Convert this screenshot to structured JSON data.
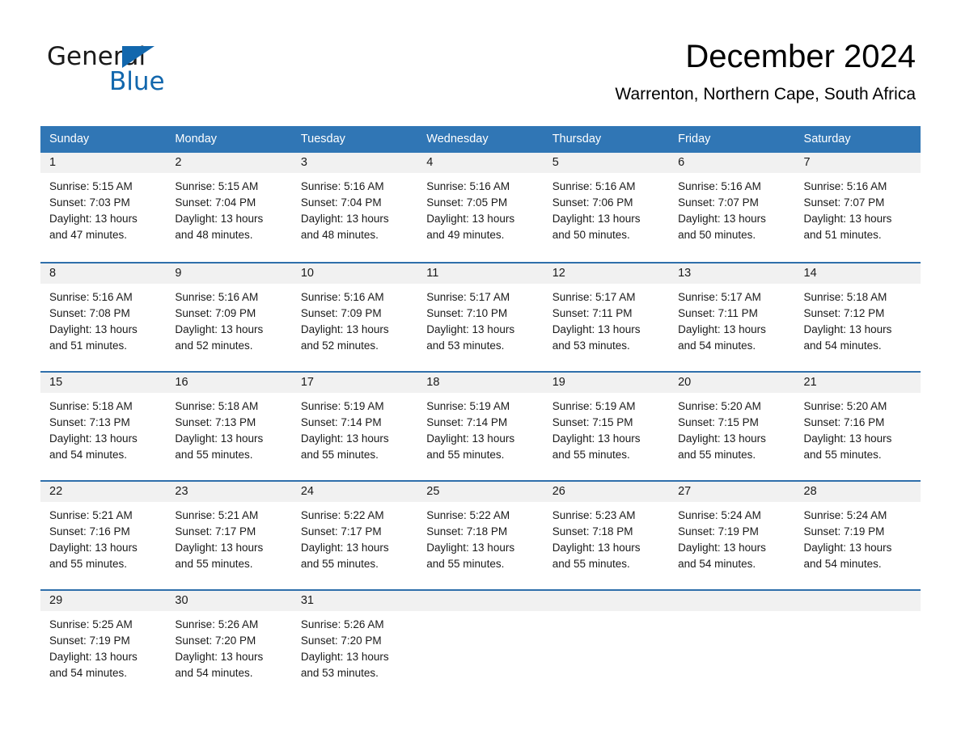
{
  "brand": {
    "name_part1": "General",
    "name_part2": "Blue",
    "accent_color": "#1267ad"
  },
  "header": {
    "month_title": "December 2024",
    "location": "Warrenton, Northern Cape, South Africa"
  },
  "calendar": {
    "header_color": "#3076b5",
    "row_border_color": "#2f6fab",
    "day_band_color": "#f1f1f1",
    "weekdays": [
      "Sunday",
      "Monday",
      "Tuesday",
      "Wednesday",
      "Thursday",
      "Friday",
      "Saturday"
    ],
    "weeks": [
      [
        {
          "day": "1",
          "sunrise": "Sunrise: 5:15 AM",
          "sunset": "Sunset: 7:03 PM",
          "daylight_line1": "Daylight: 13 hours",
          "daylight_line2": "and 47 minutes."
        },
        {
          "day": "2",
          "sunrise": "Sunrise: 5:15 AM",
          "sunset": "Sunset: 7:04 PM",
          "daylight_line1": "Daylight: 13 hours",
          "daylight_line2": "and 48 minutes."
        },
        {
          "day": "3",
          "sunrise": "Sunrise: 5:16 AM",
          "sunset": "Sunset: 7:04 PM",
          "daylight_line1": "Daylight: 13 hours",
          "daylight_line2": "and 48 minutes."
        },
        {
          "day": "4",
          "sunrise": "Sunrise: 5:16 AM",
          "sunset": "Sunset: 7:05 PM",
          "daylight_line1": "Daylight: 13 hours",
          "daylight_line2": "and 49 minutes."
        },
        {
          "day": "5",
          "sunrise": "Sunrise: 5:16 AM",
          "sunset": "Sunset: 7:06 PM",
          "daylight_line1": "Daylight: 13 hours",
          "daylight_line2": "and 50 minutes."
        },
        {
          "day": "6",
          "sunrise": "Sunrise: 5:16 AM",
          "sunset": "Sunset: 7:07 PM",
          "daylight_line1": "Daylight: 13 hours",
          "daylight_line2": "and 50 minutes."
        },
        {
          "day": "7",
          "sunrise": "Sunrise: 5:16 AM",
          "sunset": "Sunset: 7:07 PM",
          "daylight_line1": "Daylight: 13 hours",
          "daylight_line2": "and 51 minutes."
        }
      ],
      [
        {
          "day": "8",
          "sunrise": "Sunrise: 5:16 AM",
          "sunset": "Sunset: 7:08 PM",
          "daylight_line1": "Daylight: 13 hours",
          "daylight_line2": "and 51 minutes."
        },
        {
          "day": "9",
          "sunrise": "Sunrise: 5:16 AM",
          "sunset": "Sunset: 7:09 PM",
          "daylight_line1": "Daylight: 13 hours",
          "daylight_line2": "and 52 minutes."
        },
        {
          "day": "10",
          "sunrise": "Sunrise: 5:16 AM",
          "sunset": "Sunset: 7:09 PM",
          "daylight_line1": "Daylight: 13 hours",
          "daylight_line2": "and 52 minutes."
        },
        {
          "day": "11",
          "sunrise": "Sunrise: 5:17 AM",
          "sunset": "Sunset: 7:10 PM",
          "daylight_line1": "Daylight: 13 hours",
          "daylight_line2": "and 53 minutes."
        },
        {
          "day": "12",
          "sunrise": "Sunrise: 5:17 AM",
          "sunset": "Sunset: 7:11 PM",
          "daylight_line1": "Daylight: 13 hours",
          "daylight_line2": "and 53 minutes."
        },
        {
          "day": "13",
          "sunrise": "Sunrise: 5:17 AM",
          "sunset": "Sunset: 7:11 PM",
          "daylight_line1": "Daylight: 13 hours",
          "daylight_line2": "and 54 minutes."
        },
        {
          "day": "14",
          "sunrise": "Sunrise: 5:18 AM",
          "sunset": "Sunset: 7:12 PM",
          "daylight_line1": "Daylight: 13 hours",
          "daylight_line2": "and 54 minutes."
        }
      ],
      [
        {
          "day": "15",
          "sunrise": "Sunrise: 5:18 AM",
          "sunset": "Sunset: 7:13 PM",
          "daylight_line1": "Daylight: 13 hours",
          "daylight_line2": "and 54 minutes."
        },
        {
          "day": "16",
          "sunrise": "Sunrise: 5:18 AM",
          "sunset": "Sunset: 7:13 PM",
          "daylight_line1": "Daylight: 13 hours",
          "daylight_line2": "and 55 minutes."
        },
        {
          "day": "17",
          "sunrise": "Sunrise: 5:19 AM",
          "sunset": "Sunset: 7:14 PM",
          "daylight_line1": "Daylight: 13 hours",
          "daylight_line2": "and 55 minutes."
        },
        {
          "day": "18",
          "sunrise": "Sunrise: 5:19 AM",
          "sunset": "Sunset: 7:14 PM",
          "daylight_line1": "Daylight: 13 hours",
          "daylight_line2": "and 55 minutes."
        },
        {
          "day": "19",
          "sunrise": "Sunrise: 5:19 AM",
          "sunset": "Sunset: 7:15 PM",
          "daylight_line1": "Daylight: 13 hours",
          "daylight_line2": "and 55 minutes."
        },
        {
          "day": "20",
          "sunrise": "Sunrise: 5:20 AM",
          "sunset": "Sunset: 7:15 PM",
          "daylight_line1": "Daylight: 13 hours",
          "daylight_line2": "and 55 minutes."
        },
        {
          "day": "21",
          "sunrise": "Sunrise: 5:20 AM",
          "sunset": "Sunset: 7:16 PM",
          "daylight_line1": "Daylight: 13 hours",
          "daylight_line2": "and 55 minutes."
        }
      ],
      [
        {
          "day": "22",
          "sunrise": "Sunrise: 5:21 AM",
          "sunset": "Sunset: 7:16 PM",
          "daylight_line1": "Daylight: 13 hours",
          "daylight_line2": "and 55 minutes."
        },
        {
          "day": "23",
          "sunrise": "Sunrise: 5:21 AM",
          "sunset": "Sunset: 7:17 PM",
          "daylight_line1": "Daylight: 13 hours",
          "daylight_line2": "and 55 minutes."
        },
        {
          "day": "24",
          "sunrise": "Sunrise: 5:22 AM",
          "sunset": "Sunset: 7:17 PM",
          "daylight_line1": "Daylight: 13 hours",
          "daylight_line2": "and 55 minutes."
        },
        {
          "day": "25",
          "sunrise": "Sunrise: 5:22 AM",
          "sunset": "Sunset: 7:18 PM",
          "daylight_line1": "Daylight: 13 hours",
          "daylight_line2": "and 55 minutes."
        },
        {
          "day": "26",
          "sunrise": "Sunrise: 5:23 AM",
          "sunset": "Sunset: 7:18 PM",
          "daylight_line1": "Daylight: 13 hours",
          "daylight_line2": "and 55 minutes."
        },
        {
          "day": "27",
          "sunrise": "Sunrise: 5:24 AM",
          "sunset": "Sunset: 7:19 PM",
          "daylight_line1": "Daylight: 13 hours",
          "daylight_line2": "and 54 minutes."
        },
        {
          "day": "28",
          "sunrise": "Sunrise: 5:24 AM",
          "sunset": "Sunset: 7:19 PM",
          "daylight_line1": "Daylight: 13 hours",
          "daylight_line2": "and 54 minutes."
        }
      ],
      [
        {
          "day": "29",
          "sunrise": "Sunrise: 5:25 AM",
          "sunset": "Sunset: 7:19 PM",
          "daylight_line1": "Daylight: 13 hours",
          "daylight_line2": "and 54 minutes."
        },
        {
          "day": "30",
          "sunrise": "Sunrise: 5:26 AM",
          "sunset": "Sunset: 7:20 PM",
          "daylight_line1": "Daylight: 13 hours",
          "daylight_line2": "and 54 minutes."
        },
        {
          "day": "31",
          "sunrise": "Sunrise: 5:26 AM",
          "sunset": "Sunset: 7:20 PM",
          "daylight_line1": "Daylight: 13 hours",
          "daylight_line2": "and 53 minutes."
        },
        {
          "day": "",
          "sunrise": "",
          "sunset": "",
          "daylight_line1": "",
          "daylight_line2": ""
        },
        {
          "day": "",
          "sunrise": "",
          "sunset": "",
          "daylight_line1": "",
          "daylight_line2": ""
        },
        {
          "day": "",
          "sunrise": "",
          "sunset": "",
          "daylight_line1": "",
          "daylight_line2": ""
        },
        {
          "day": "",
          "sunrise": "",
          "sunset": "",
          "daylight_line1": "",
          "daylight_line2": ""
        }
      ]
    ]
  }
}
